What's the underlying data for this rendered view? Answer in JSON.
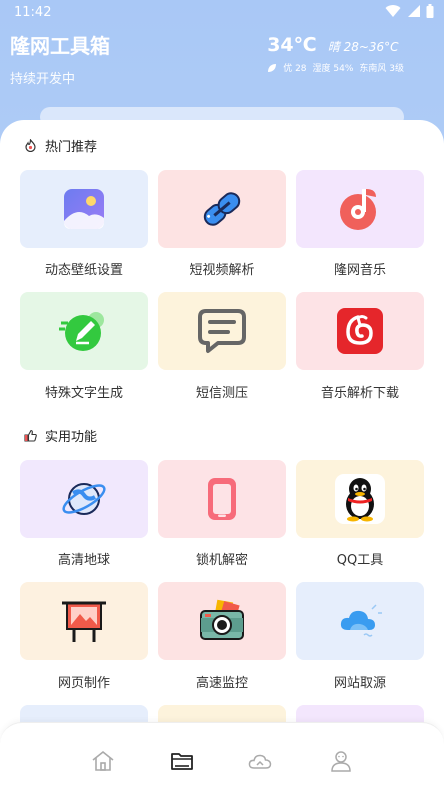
{
  "status_bar": {
    "time": "11:42"
  },
  "header": {
    "title": "隆网工具箱",
    "subtitle": "持续开发中"
  },
  "weather": {
    "temperature": "34℃",
    "range": "晴 28~36°C",
    "aqi": "优 28",
    "humidity": "湿度 54%",
    "wind": "东南风 3级"
  },
  "sections": {
    "hot": {
      "title": "热门推荐"
    },
    "utility": {
      "title": "实用功能"
    }
  },
  "tools": [
    {
      "label": "动态壁纸设置",
      "icon": "image-icon",
      "bg": "#e6eefc"
    },
    {
      "label": "短视频解析",
      "icon": "link-icon",
      "bg": "#fde3e3"
    },
    {
      "label": "隆网音乐",
      "icon": "music-icon",
      "bg": "#f3e6fd"
    },
    {
      "label": "特殊文字生成",
      "icon": "pencil-icon",
      "bg": "#e5f7e6"
    },
    {
      "label": "短信测压",
      "icon": "message-icon",
      "bg": "#fdf3dc"
    },
    {
      "label": "音乐解析下载",
      "icon": "netease-music-icon",
      "bg": "#fde3e6"
    },
    {
      "label": "高清地球",
      "icon": "planet-icon",
      "bg": "#f1e8fd"
    },
    {
      "label": "锁机解密",
      "icon": "phone-icon",
      "bg": "#fde3e6"
    },
    {
      "label": "QQ工具",
      "icon": "qq-penguin-icon",
      "bg": "#fdf3dc"
    },
    {
      "label": "网页制作",
      "icon": "billboard-icon",
      "bg": "#fdf1e0"
    },
    {
      "label": "高速监控",
      "icon": "camera-icon",
      "bg": "#fde3e3"
    },
    {
      "label": "网站取源",
      "icon": "cloud-icon",
      "bg": "#e6eefc"
    }
  ],
  "nav": [
    "home-icon",
    "folder-icon",
    "cloud-nav-icon",
    "profile-icon"
  ],
  "colors": {
    "header_bg": "#a9c8f6",
    "panel_bg": "#ffffff",
    "nav_icon": "#aaaaaa"
  }
}
